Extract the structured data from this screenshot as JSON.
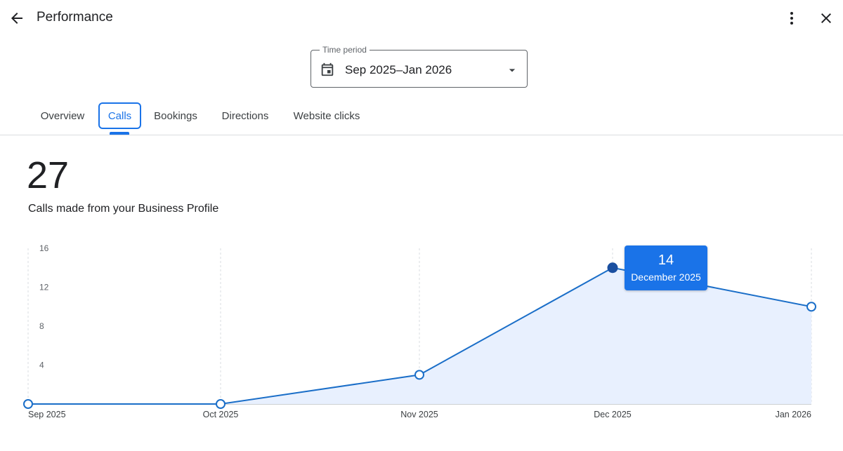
{
  "header": {
    "title": "Performance",
    "back_icon": "arrow-back-icon",
    "more_icon": "more-vert-icon",
    "close_icon": "close-icon"
  },
  "time_period": {
    "label": "Time period",
    "value": "Sep 2025–Jan 2026",
    "icon": "calendar-icon"
  },
  "tabs": [
    {
      "label": "Overview",
      "active": false
    },
    {
      "label": "Calls",
      "active": true
    },
    {
      "label": "Bookings",
      "active": false
    },
    {
      "label": "Directions",
      "active": false
    },
    {
      "label": "Website clicks",
      "active": false
    }
  ],
  "metric": {
    "value": "27",
    "description": "Calls made from your Business Profile"
  },
  "colors": {
    "accent": "#1a73e8",
    "line": "#1a6ec8",
    "fill": "#e8f0fe"
  },
  "chart_data": {
    "type": "area",
    "categories": [
      "Sep 2025",
      "Oct 2025",
      "Nov 2025",
      "Dec 2025",
      "Jan 2026"
    ],
    "values": [
      0,
      0,
      3,
      14,
      10
    ],
    "y_ticks": [
      "4",
      "8",
      "12",
      "16"
    ],
    "ylim": [
      0,
      16
    ],
    "grid": "vertical dashed",
    "tooltip": {
      "value": "14",
      "label": "December 2025",
      "index": 3
    }
  }
}
